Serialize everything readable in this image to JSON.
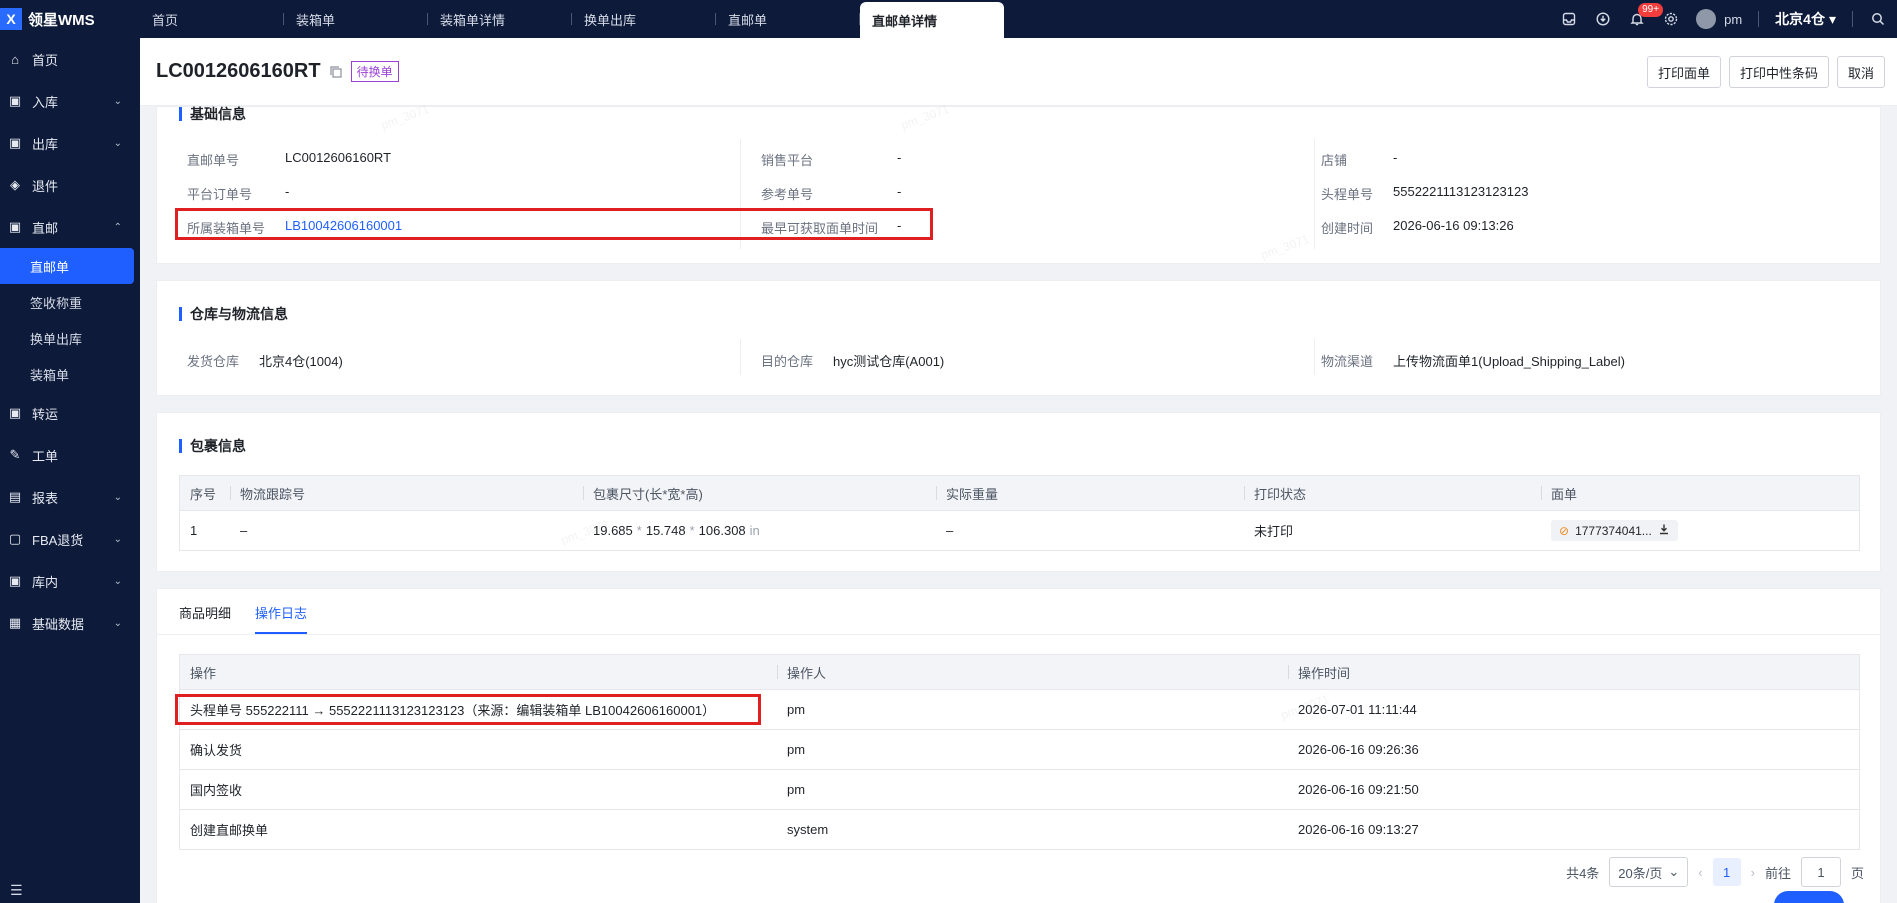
{
  "app": {
    "name": "领星WMS",
    "logo_glyph": "X"
  },
  "tabs": [
    {
      "label": "首页"
    },
    {
      "label": "装箱单"
    },
    {
      "label": "装箱单详情"
    },
    {
      "label": "换单出库"
    },
    {
      "label": "直邮单"
    },
    {
      "label": "直邮单详情"
    }
  ],
  "topbar": {
    "badge": "99+",
    "user": "pm",
    "warehouse": "北京4仓"
  },
  "sidebar": {
    "items": [
      {
        "label": "首页"
      },
      {
        "label": "入库"
      },
      {
        "label": "出库"
      },
      {
        "label": "退件"
      },
      {
        "label": "直邮"
      },
      {
        "label": "转运"
      },
      {
        "label": "工单"
      },
      {
        "label": "报表"
      },
      {
        "label": "FBA退货"
      },
      {
        "label": "库内"
      },
      {
        "label": "基础数据"
      }
    ],
    "sub": [
      {
        "label": "直邮单"
      },
      {
        "label": "签收称重"
      },
      {
        "label": "换单出库"
      },
      {
        "label": "装箱单"
      }
    ]
  },
  "header": {
    "title": "LC0012606160RT",
    "status": "待换单",
    "actions": {
      "print_label": "打印面单",
      "print_neutral": "打印中性条码",
      "cancel": "取消"
    }
  },
  "basic": {
    "title": "基础信息",
    "fields": {
      "order_no": {
        "k": "直邮单号",
        "v": "LC0012606160RT"
      },
      "platform_order": {
        "k": "平台订单号",
        "v": "-"
      },
      "box_no": {
        "k": "所属装箱单号",
        "v": "LB10042606160001"
      },
      "platform": {
        "k": "销售平台",
        "v": "-"
      },
      "ref_no": {
        "k": "参考单号",
        "v": "-"
      },
      "earliest": {
        "k": "最早可获取面单时间",
        "v": "-"
      },
      "shop": {
        "k": "店铺",
        "v": "-"
      },
      "head_no": {
        "k": "头程单号",
        "v": "5552221113123123123"
      },
      "created": {
        "k": "创建时间",
        "v": "2026-06-16 09:13:26"
      }
    }
  },
  "logistics": {
    "title": "仓库与物流信息",
    "fields": {
      "from": {
        "k": "发货仓库",
        "v": "北京4仓(1004)"
      },
      "to": {
        "k": "目的仓库",
        "v": "hyc测试仓库(A001)"
      },
      "channel": {
        "k": "物流渠道",
        "v": "上传物流面单1(Upload_Shipping_Label)"
      }
    }
  },
  "packages": {
    "title": "包裹信息",
    "headers": [
      "序号",
      "物流跟踪号",
      "包裹尺寸(长*宽*高)",
      "实际重量",
      "打印状态",
      "面单"
    ],
    "row": {
      "idx": "1",
      "tracking": "–",
      "l": "19.685",
      "w": "15.748",
      "h": "106.308",
      "unit": "in",
      "x": "*",
      "weight": "–",
      "print_status": "未打印",
      "file": "1777374041..."
    }
  },
  "detail_tabs": {
    "goods": "商品明细",
    "log": "操作日志"
  },
  "log": {
    "headers": [
      "操作",
      "操作人",
      "操作时间"
    ],
    "rows": [
      {
        "op": "头程单号 555222111 → 5552221113123123123（来源：编辑装箱单 LB10042606160001）",
        "user": "pm",
        "time": "2026-07-01 11:11:44"
      },
      {
        "op": "确认发货",
        "user": "pm",
        "time": "2026-06-16 09:26:36"
      },
      {
        "op": "国内签收",
        "user": "pm",
        "time": "2026-06-16 09:21:50"
      },
      {
        "op": "创建直邮换单",
        "user": "system",
        "time": "2026-06-16 09:13:27"
      }
    ]
  },
  "pager": {
    "total": "共4条",
    "page_size": "20条/页",
    "current": "1",
    "goto_label": "前往",
    "goto_value": "1",
    "page_suffix": "页"
  },
  "watermark": "pm_3071"
}
